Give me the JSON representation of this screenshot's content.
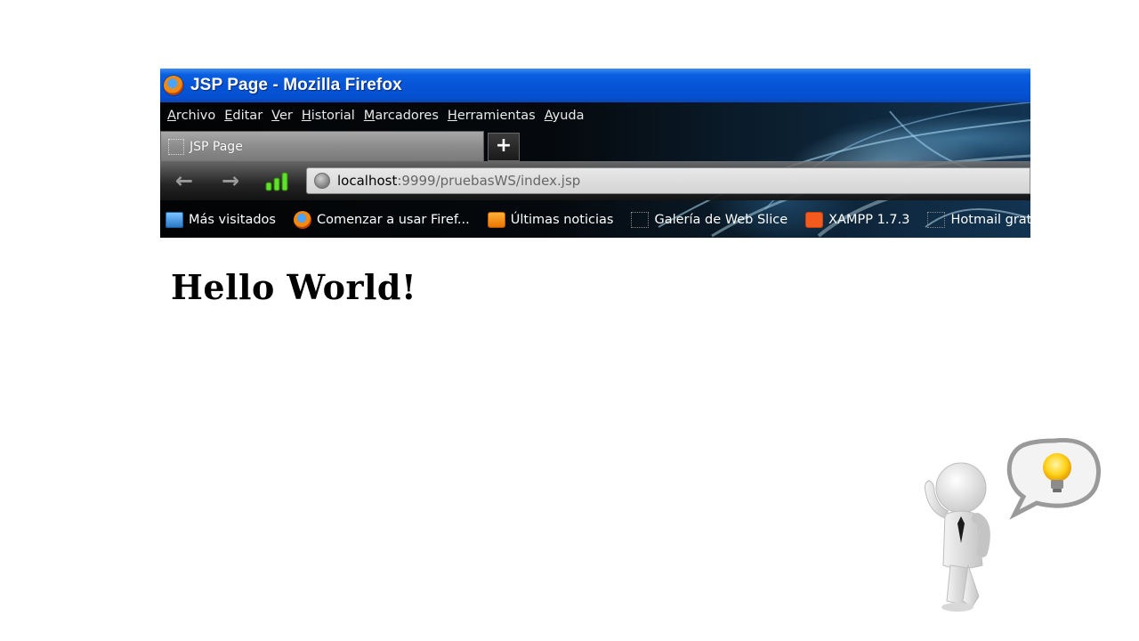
{
  "window": {
    "title": "JSP Page - Mozilla Firefox"
  },
  "menu": {
    "items": [
      "Archivo",
      "Editar",
      "Ver",
      "Historial",
      "Marcadores",
      "Herramientas",
      "Ayuda"
    ]
  },
  "tabs": {
    "active_tab_label": "JSP Page",
    "new_tab_label": "+"
  },
  "navigation": {
    "url_host": "localhost",
    "url_rest": ":9999/pruebasWS/index.jsp"
  },
  "bookmarks": [
    {
      "label": "Más visitados",
      "icon": "folder-search-icon"
    },
    {
      "label": "Comenzar a usar Firef...",
      "icon": "firefox-icon"
    },
    {
      "label": "Últimas noticias",
      "icon": "rss-icon"
    },
    {
      "label": "Galería de Web Slice",
      "icon": "webslice-icon"
    },
    {
      "label": "XAMPP 1.7.3",
      "icon": "xampp-icon"
    },
    {
      "label": "Hotmail gratuito",
      "icon": "webslice-icon"
    }
  ],
  "page": {
    "heading": "Hello World!"
  },
  "colors": {
    "titlebar": "#0654d8",
    "page_background": "#ffffff"
  }
}
